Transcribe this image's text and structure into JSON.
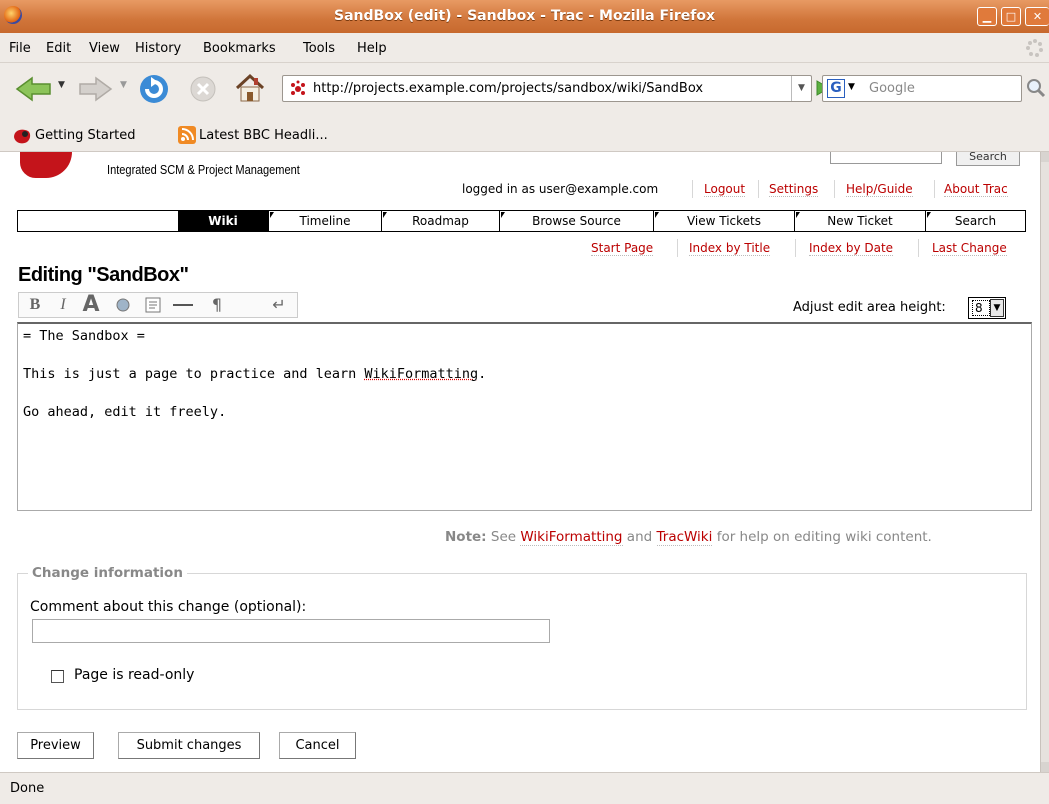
{
  "window": {
    "title": "SandBox (edit) - Sandbox - Trac - Mozilla Firefox"
  },
  "menubar": {
    "items": [
      "File",
      "Edit",
      "View",
      "History",
      "Bookmarks",
      "Tools",
      "Help"
    ]
  },
  "navbar": {
    "url": "http://projects.example.com/projects/sandbox/wiki/SandBox",
    "search_engine": "G",
    "search_placeholder": "Google"
  },
  "bookmarks": {
    "items": [
      "Getting Started",
      "Latest BBC Headli..."
    ]
  },
  "trac": {
    "tagline": "Integrated SCM & Project Management",
    "top_search_button": "Search",
    "metanav": {
      "logged_in": "logged in as user@example.com",
      "links": [
        "Logout",
        "Settings",
        "Help/Guide",
        "About Trac"
      ]
    },
    "mainnav": [
      "Wiki",
      "Timeline",
      "Roadmap",
      "Browse Source",
      "View Tickets",
      "New Ticket",
      "Search"
    ],
    "ctxnav": [
      "Start Page",
      "Index by Title",
      "Index by Date",
      "Last Change"
    ],
    "page_title": "Editing \"SandBox\"",
    "wiki_toolbar": [
      "bold",
      "italic",
      "heading",
      "link",
      "code-block",
      "horizontal-rule",
      "paragraph",
      "line-break"
    ],
    "adjust_label": "Adjust edit area height:",
    "adjust_value": "8",
    "editor_lines": [
      "= The Sandbox =",
      "",
      "This is just a page to practice and learn WikiFormatting.",
      "",
      "Go ahead, edit it freely."
    ],
    "editor_link_word": "WikiFormatting",
    "note": {
      "label": "Note:",
      "pre": "See",
      "link1": "WikiFormatting",
      "mid": "and",
      "link2": "TracWiki",
      "post": "for help on editing wiki content."
    },
    "change_info": {
      "legend": "Change information",
      "comment_label": "Comment about this change (optional):",
      "comment_value": "",
      "readonly_label": "Page is read-only",
      "readonly_checked": false
    },
    "buttons": {
      "preview": "Preview",
      "submit": "Submit changes",
      "cancel": "Cancel"
    }
  },
  "status": "Done"
}
